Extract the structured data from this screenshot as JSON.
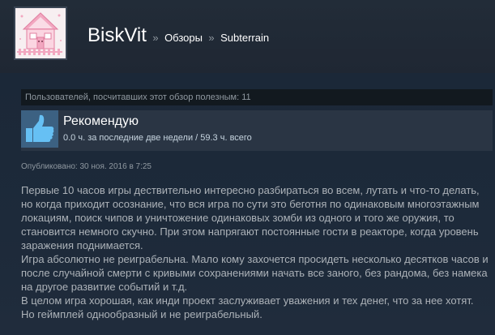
{
  "header": {
    "username": "BiskVit",
    "separator": "»",
    "breadcrumb_reviews": "Обзоры",
    "breadcrumb_game": "Subterrain"
  },
  "review": {
    "helpful_text": "Пользователей, посчитавших этот обзор полезным: 11",
    "recommendation": "Рекомендую",
    "hours": "0.0 ч. за последние две недели / 59.3 ч. всего",
    "posted": "Опубликовано: 30 ноя. 2016 в 7:25",
    "body_lines": [
      "Первые 10 часов игры дествительно интересно разбираться во всем, лутать и что-то делать,",
      "но когда приходит осознание, что вся игра по сути это беготня по одинаковым многоэтажным",
      "локациям, поиск чипов и уничтожение одинаковых зомби из одного и того же оружия, то",
      "становится немного скучно. При этом напрягают постоянные гости в реакторе, когда уровень",
      "заражения поднимается.",
      "Игра абсолютно не реиграбельна. Мало кому захочется просидеть несколько десятков часов и",
      "после случайной смерти с кривыми сохранениями начать все заного, без рандома, без намека",
      "на другое развитие событий и т.д.",
      "В целом игра хорошая, как инди проект заслуживает уважения и тех денег, что за нее хотят.",
      "Но геймплей однообразный и не реиграбельный."
    ]
  },
  "icons": {
    "avatar": "pink-house-avatar",
    "thumb": "thumbs-up-icon"
  },
  "colors": {
    "background": "#1b2838",
    "thumb_box": "#3c6182",
    "thumb": "#66c0f4"
  }
}
